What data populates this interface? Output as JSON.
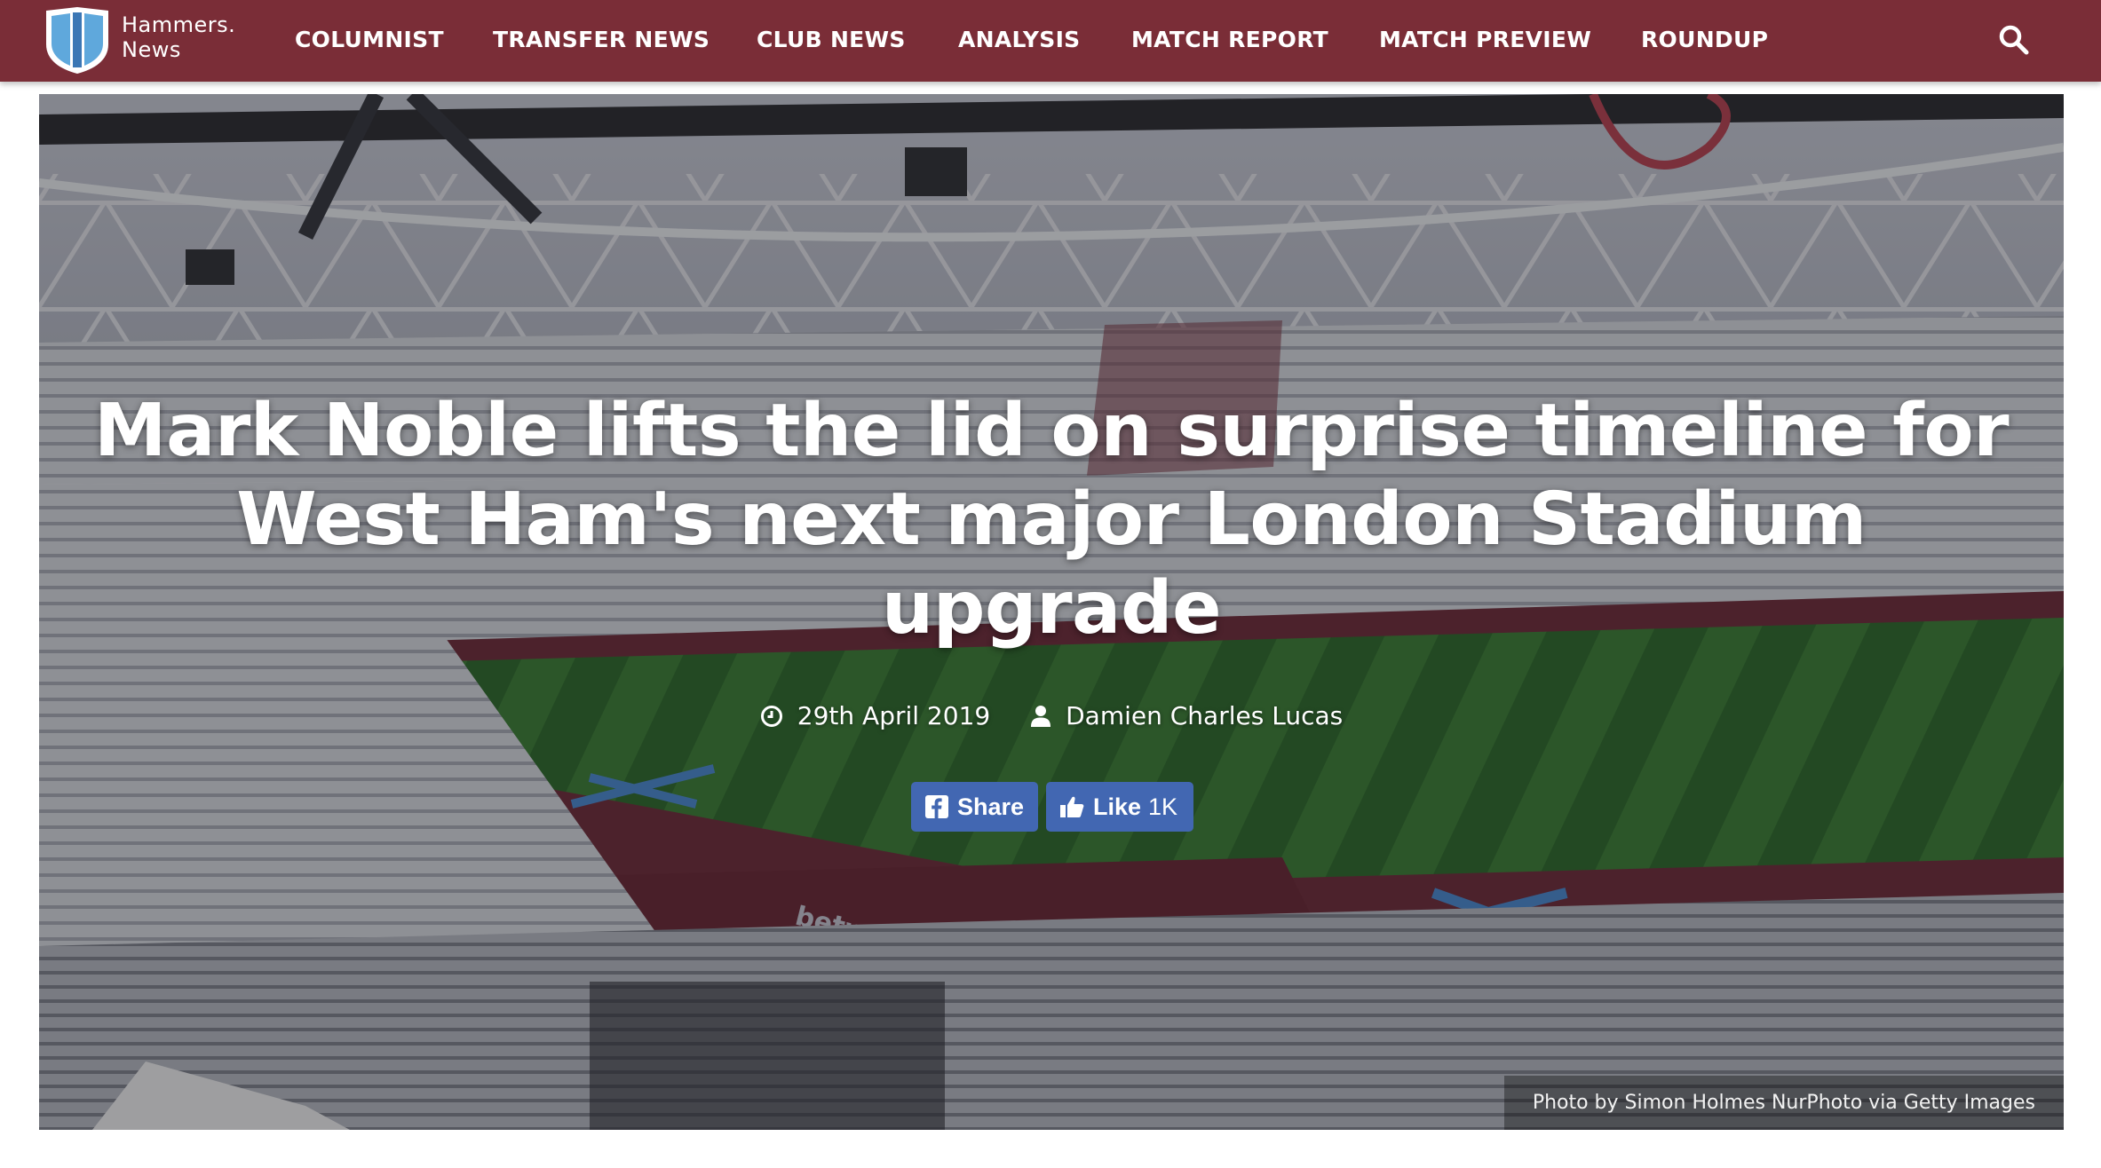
{
  "brand": {
    "line1": "Hammers.",
    "line2": "News"
  },
  "nav": {
    "items": [
      "COLUMNIST",
      "TRANSFER NEWS",
      "CLUB NEWS",
      "ANALYSIS",
      "MATCH REPORT",
      "MATCH PREVIEW",
      "ROUNDUP"
    ],
    "search_icon": "search-icon"
  },
  "article": {
    "title": "Mark Noble lifts the lid on surprise timeline for West Ham's next major London Stadium upgrade",
    "title_lines": [
      "Mark Noble lifts the lid on surprise timeline for",
      "West Ham's next major London Stadium",
      "upgrade"
    ],
    "date": "29th April 2019",
    "author": "Damien Charles Lucas",
    "date_icon": "clock-icon",
    "author_icon": "user-icon",
    "photo_credit": "Photo by Simon Holmes NurPhoto via Getty Images"
  },
  "social": {
    "share_label": "Share",
    "like_label": "Like",
    "like_count": "1K"
  },
  "colors": {
    "nav_bg": "#7a2d37",
    "facebook_blue": "#4267b2",
    "text": "#ffffff"
  }
}
